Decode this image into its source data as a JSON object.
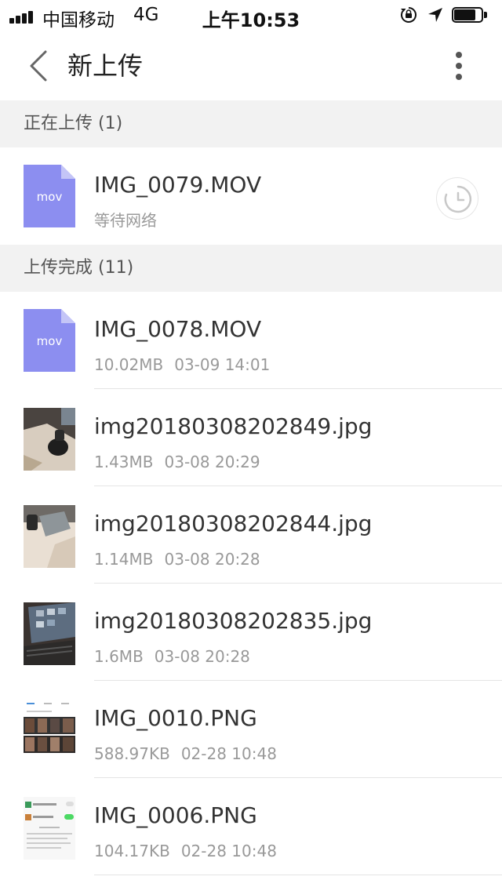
{
  "status_bar": {
    "carrier": "中国移动",
    "network": "4G",
    "time": "上午10:53"
  },
  "nav": {
    "title": "新上传"
  },
  "uploading": {
    "header": "正在上传 (1)",
    "items": [
      {
        "name": "IMG_0079.MOV",
        "status": "等待网络",
        "icon_label": "mov",
        "icon": "mov-file-icon"
      }
    ]
  },
  "completed": {
    "header": "上传完成 (11)",
    "items": [
      {
        "name": "IMG_0078.MOV",
        "size": "10.02MB",
        "date": "03-09 14:01",
        "icon_label": "mov",
        "icon": "mov-file-icon"
      },
      {
        "name": "img20180308202849.jpg",
        "size": "1.43MB",
        "date": "03-08 20:29",
        "icon": "photo-thumbnail"
      },
      {
        "name": "img20180308202844.jpg",
        "size": "1.14MB",
        "date": "03-08 20:28",
        "icon": "photo-thumbnail"
      },
      {
        "name": "img20180308202835.jpg",
        "size": "1.6MB",
        "date": "03-08 20:28",
        "icon": "photo-thumbnail"
      },
      {
        "name": "IMG_0010.PNG",
        "size": "588.97KB",
        "date": "02-28 10:48",
        "icon": "screenshot-thumbnail"
      },
      {
        "name": "IMG_0006.PNG",
        "size": "104.17KB",
        "date": "02-28 10:48",
        "icon": "screenshot-thumbnail"
      }
    ]
  },
  "colors": {
    "mov_icon": "#8c8ef0",
    "mov_icon_fold": "#c4c5f7",
    "section_bg": "#f2f2f2",
    "meta_text": "#999999"
  }
}
